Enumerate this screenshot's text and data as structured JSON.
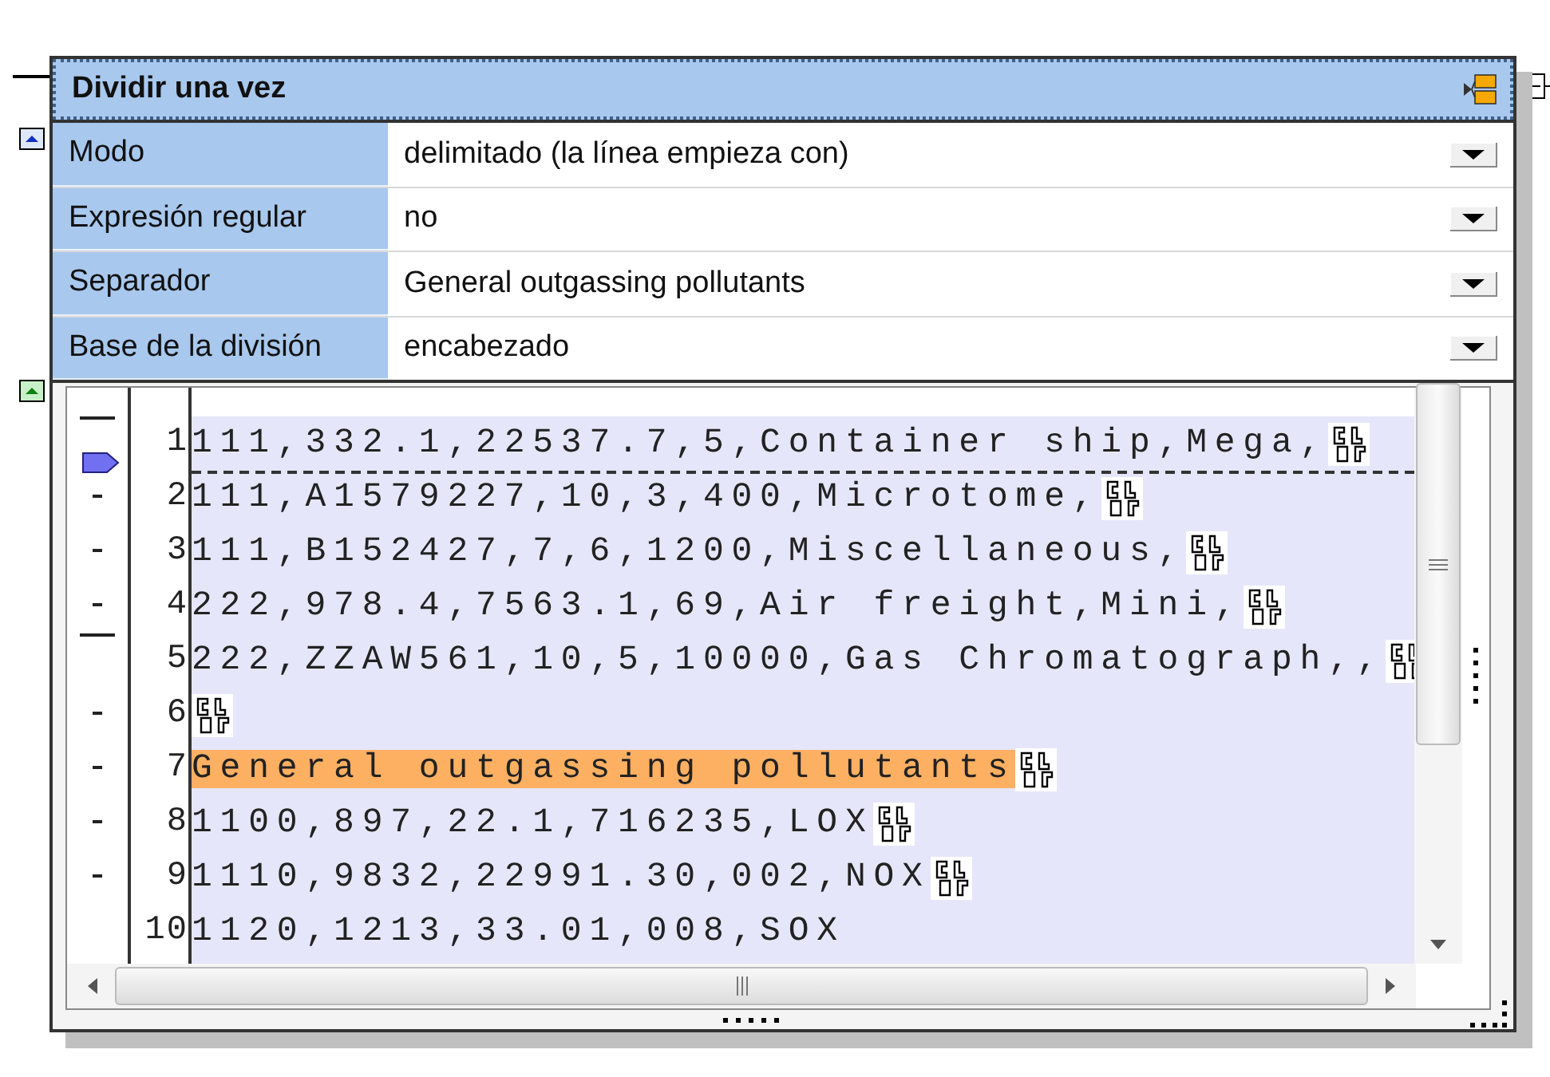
{
  "node": {
    "title": "Dividir una vez"
  },
  "properties": [
    {
      "label": "Modo",
      "value": "delimitado (la línea empieza con)"
    },
    {
      "label": "Expresión regular",
      "value": "no"
    },
    {
      "label": "Separador",
      "value": "General outgassing pollutants"
    },
    {
      "label": "Base de la división",
      "value": "encabezado"
    }
  ],
  "lines": [
    {
      "number": "1",
      "text": "111,332.1,22537.7,5,Container ship,Mega,",
      "line_break": true,
      "highlighted": false,
      "marked": true,
      "long": true,
      "split_after": true
    },
    {
      "number": "2",
      "text": "111,A1579227,10,3,400,Microtome,",
      "line_break": true,
      "highlighted": false,
      "marked": true,
      "long": false,
      "split_after": false
    },
    {
      "number": "3",
      "text": "111,B152427,7,6,1200,Miscellaneous,",
      "line_break": true,
      "highlighted": false,
      "marked": true,
      "long": false,
      "split_after": false
    },
    {
      "number": "4",
      "text": "222,978.4,7563.1,69,Air freight,Mini,",
      "line_break": true,
      "highlighted": false,
      "marked": true,
      "long": false,
      "split_after": false
    },
    {
      "number": "5",
      "text": "222,ZZAW561,10,5,10000,Gas Chromatograph,,",
      "line_break": true,
      "highlighted": false,
      "marked": true,
      "long": true,
      "split_after": false
    },
    {
      "number": "6",
      "line_break": true,
      "highlighted": false,
      "marked": true,
      "long": false,
      "split_after": false
    },
    {
      "number": "7",
      "text": "General outgassing pollutants",
      "line_break": true,
      "highlighted": true,
      "marked": true,
      "long": false,
      "split_after": false
    },
    {
      "number": "8",
      "text": "1100,897,22.1,716235,LOX",
      "line_break": true,
      "highlighted": false,
      "marked": true,
      "long": false,
      "split_after": false
    },
    {
      "number": "9",
      "text": "1110,9832,22991.30,002,NOX",
      "line_break": true,
      "highlighted": false,
      "marked": true,
      "long": false,
      "split_after": false
    },
    {
      "number": "10",
      "text": "1120,1213,33.01,008,SOX",
      "line_break": false,
      "highlighted": false,
      "marked": false,
      "split_after": false
    }
  ]
}
